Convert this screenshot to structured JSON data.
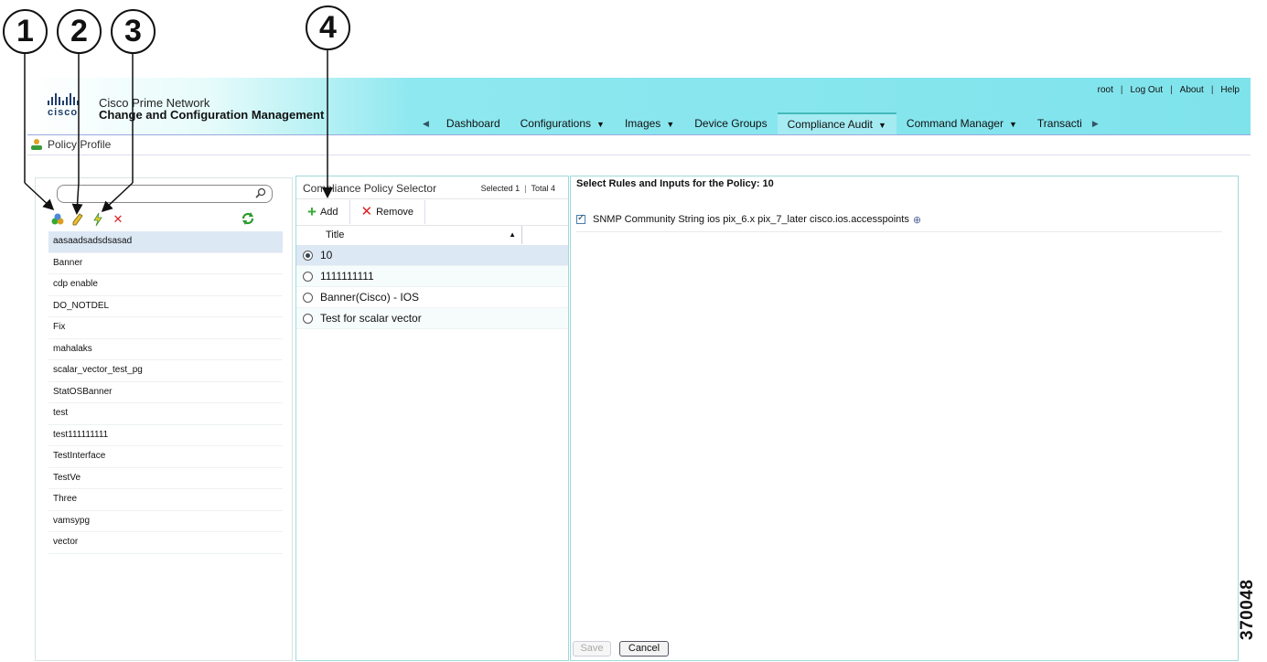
{
  "app": {
    "vendor": "cisco",
    "product_line1": "Cisco Prime Network",
    "product_line2": "Change and Configuration Management"
  },
  "top_links": {
    "user": "root",
    "logout": "Log Out",
    "about": "About",
    "help": "Help"
  },
  "nav": {
    "items": [
      "Dashboard",
      "Configurations",
      "Images",
      "Device Groups",
      "Compliance Audit",
      "Command Manager",
      "Transacti"
    ],
    "active": "Compliance Audit"
  },
  "breadcrumb": {
    "label": "Policy Profile"
  },
  "left_panel": {
    "search_placeholder": "",
    "policies": [
      "aasaadsadsdsasad",
      "Banner",
      "cdp enable",
      "DO_NOTDEL",
      "Fix",
      "mahalaks",
      "scalar_vector_test_pg",
      "StatOSBanner",
      "test",
      "test111111111",
      "TestInterface",
      "TestVe",
      "Three",
      "vamsypg",
      "vector"
    ],
    "selected_index": 0
  },
  "selector": {
    "title": "Compliance Policy Selector",
    "selected_label": "Selected 1",
    "total_label": "Total 4",
    "add_label": "Add",
    "remove_label": "Remove",
    "column_title": "Title",
    "rows": [
      "10",
      "1111111111",
      "Banner(Cisco) - IOS",
      "Test for scalar vector"
    ],
    "selected_index": 0
  },
  "rules": {
    "title": "Select Rules and Inputs for the Policy: 10",
    "items": [
      {
        "label": "SNMP Community String ios pix_6.x pix_7_later cisco.ios.accesspoints",
        "checked": true
      }
    ],
    "save_label": "Save",
    "cancel_label": "Cancel"
  },
  "callouts": [
    "1",
    "2",
    "3",
    "4"
  ],
  "figure_id": "370048",
  "colors": {
    "header_gradient_end": "#7fe3ec",
    "panel_border": "#9fd9dc",
    "selection": "#dce8f4",
    "delete_red": "#d22222",
    "add_green": "#33aa33"
  }
}
